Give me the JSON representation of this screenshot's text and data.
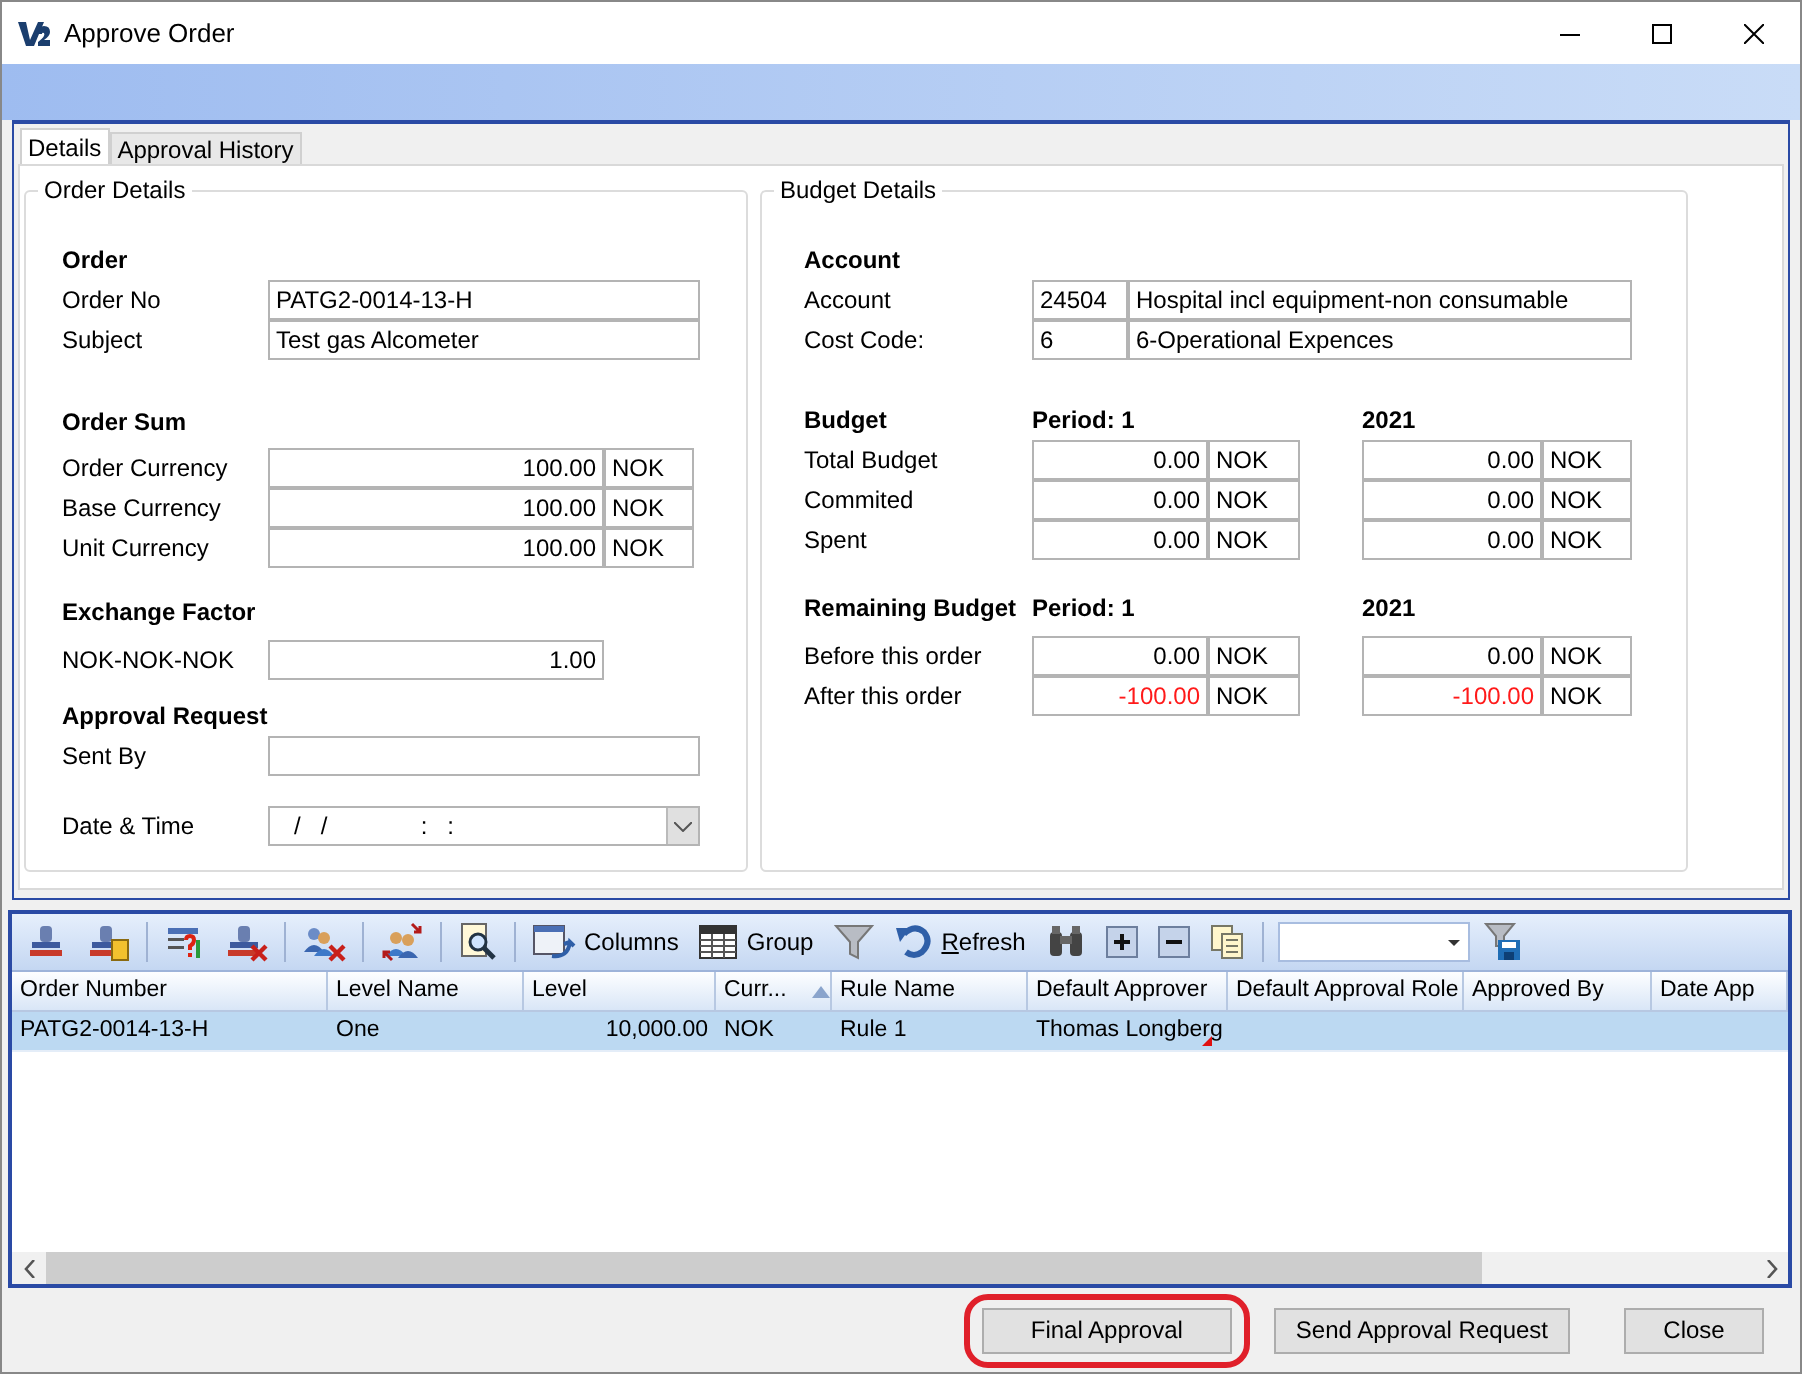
{
  "window": {
    "title": "Approve Order"
  },
  "tabs": [
    {
      "label": "Details",
      "selected": true
    },
    {
      "label": "Approval History",
      "selected": false
    }
  ],
  "order_details": {
    "title": "Order Details",
    "order": {
      "heading": "Order",
      "rows": [
        {
          "label": "Order No",
          "value": "PATG2-0014-13-H"
        },
        {
          "label": "Subject",
          "value": "Test gas Alcometer"
        }
      ]
    },
    "order_sum": {
      "heading": "Order Sum",
      "rows": [
        {
          "label": "Order Currency",
          "amount": "100.00",
          "currency": "NOK"
        },
        {
          "label": "Base Currency",
          "amount": "100.00",
          "currency": "NOK"
        },
        {
          "label": "Unit Currency",
          "amount": "100.00",
          "currency": "NOK"
        }
      ]
    },
    "exchange_factor": {
      "heading": "Exchange Factor",
      "rows": [
        {
          "label": "NOK-NOK-NOK",
          "value": "1.00"
        }
      ]
    },
    "approval_request": {
      "heading": "Approval Request",
      "sent_by": {
        "label": "Sent By"
      },
      "date_time": {
        "label": "Date & Time",
        "value": "/   /              :   :"
      }
    }
  },
  "budget_details": {
    "title": "Budget Details",
    "account": {
      "heading": "Account",
      "rows": [
        {
          "label": "Account",
          "code": "24504",
          "description": "Hospital incl equipment-non consumable"
        },
        {
          "label": "Cost Code:",
          "code": "6",
          "description": "6-Operational Expences"
        }
      ]
    },
    "budget": {
      "heading": "Budget",
      "columns": [
        "Period: 1",
        "2021"
      ],
      "rows": [
        {
          "label": "Total Budget",
          "values": [
            {
              "amount": "0.00",
              "currency": "NOK",
              "negative": false
            },
            {
              "amount": "0.00",
              "currency": "NOK",
              "negative": false
            }
          ]
        },
        {
          "label": "Commited",
          "values": [
            {
              "amount": "0.00",
              "currency": "NOK",
              "negative": false
            },
            {
              "amount": "0.00",
              "currency": "NOK",
              "negative": false
            }
          ]
        },
        {
          "label": "Spent",
          "values": [
            {
              "amount": "0.00",
              "currency": "NOK",
              "negative": false
            },
            {
              "amount": "0.00",
              "currency": "NOK",
              "negative": false
            }
          ]
        }
      ]
    },
    "remaining": {
      "heading": "Remaining Budget",
      "columns": [
        "Period: 1",
        "2021"
      ],
      "rows": [
        {
          "label": "Before this order",
          "values": [
            {
              "amount": "0.00",
              "currency": "NOK",
              "negative": false
            },
            {
              "amount": "0.00",
              "currency": "NOK",
              "negative": false
            }
          ]
        },
        {
          "label": "After this order",
          "values": [
            {
              "amount": "-100.00",
              "currency": "NOK",
              "negative": true
            },
            {
              "amount": "-100.00",
              "currency": "NOK",
              "negative": true
            }
          ]
        }
      ]
    }
  },
  "toolbar": {
    "columns_label": "Columns",
    "group_label": "Group",
    "refresh_label": "Refresh"
  },
  "grid": {
    "columns": [
      {
        "label": "Order Number",
        "sorted": false
      },
      {
        "label": "Level Name",
        "sorted": false
      },
      {
        "label": "Level",
        "sorted": false
      },
      {
        "label": "Curr...",
        "sorted": true
      },
      {
        "label": "Rule Name",
        "sorted": false
      },
      {
        "label": "Default Approver",
        "sorted": false
      },
      {
        "label": "Default Approval Role",
        "sorted": false
      },
      {
        "label": "Approved By",
        "sorted": false
      },
      {
        "label": "Date App",
        "sorted": false
      }
    ],
    "rows": [
      {
        "selected": true,
        "cells": [
          "PATG2-0014-13-H",
          "One",
          "10,000.00",
          "NOK",
          "Rule 1",
          "Thomas Longberg"
        ]
      }
    ]
  },
  "buttons": [
    {
      "label": "Final Approval",
      "highlighted": true
    },
    {
      "label": "Send Approval Request",
      "highlighted": false
    },
    {
      "label": "Close",
      "highlighted": false
    }
  ]
}
